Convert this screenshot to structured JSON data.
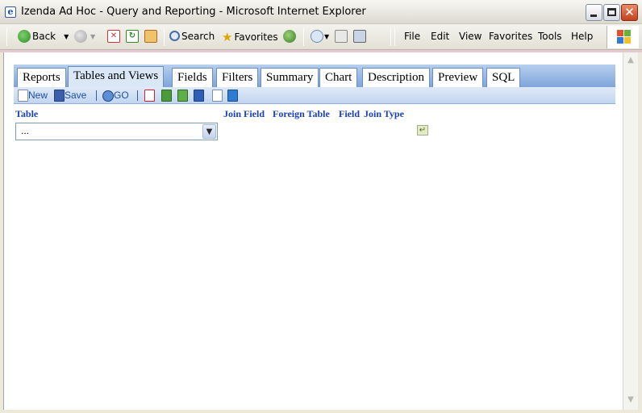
{
  "window": {
    "title": "Izenda Ad Hoc - Query and Reporting - Microsoft Internet Explorer",
    "icon": "ie-page-icon"
  },
  "browser_toolbar": {
    "back_label": "Back",
    "search_label": "Search",
    "favorites_label": "Favorites"
  },
  "menu": {
    "file": "File",
    "edit": "Edit",
    "view": "View",
    "favorites": "Favorites",
    "tools": "Tools",
    "help": "Help"
  },
  "tabs": [
    {
      "label": "Reports"
    },
    {
      "label": "Tables and Views",
      "active": true
    },
    {
      "label": "Fields"
    },
    {
      "label": "Filters"
    },
    {
      "label": "Summary"
    },
    {
      "label": "Chart"
    },
    {
      "label": "Description"
    },
    {
      "label": "Preview"
    },
    {
      "label": "SQL"
    }
  ],
  "report_toolbar": {
    "new_label": "New",
    "save_label": "Save",
    "go_label": "GO",
    "sep": "|"
  },
  "columns": {
    "table": "Table",
    "join_field": "Join Field",
    "foreign_table": "Foreign Table",
    "field": "Field",
    "join_type": "Join Type"
  },
  "table_select": {
    "selected": "..."
  },
  "colors": {
    "tab_bar": "#7fa5db",
    "column_header": "#1a3fbf",
    "link": "#1f4fa8"
  }
}
